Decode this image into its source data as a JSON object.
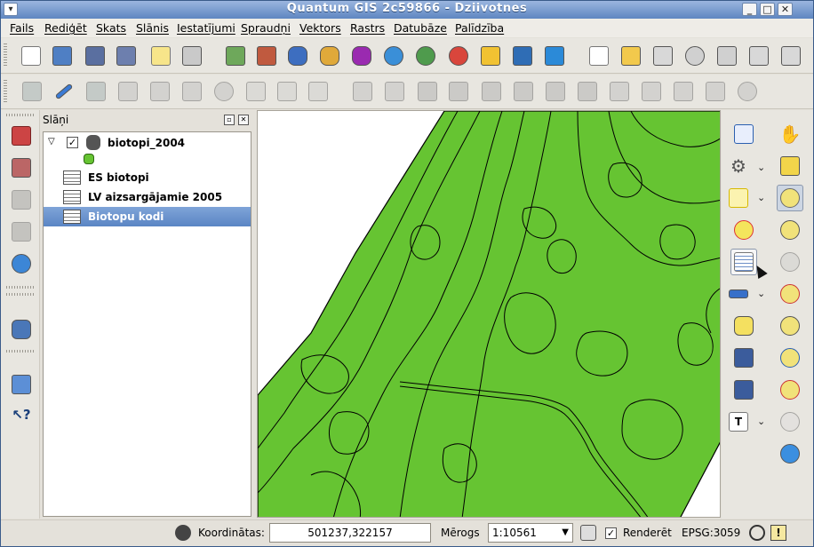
{
  "window": {
    "title": "Quantum GIS 2c59866 - Dziivotnes",
    "buttons": [
      "minimize",
      "maximize",
      "close"
    ]
  },
  "menu": {
    "items": [
      "Fails",
      "Rediģēt",
      "Skats",
      "Slānis",
      "Iestatījumi",
      "Spraudņi",
      "Vektors",
      "Rastrs",
      "Datubāze",
      "Palīdzība"
    ]
  },
  "toolbar_top": {
    "icons": [
      "new-project-icon",
      "open-project-icon",
      "save-project-icon",
      "save-as-icon",
      "print-composer-icon",
      "print-icon",
      "add-vector-icon",
      "add-raster-icon",
      "add-postgis-icon",
      "add-spatialite-icon",
      "add-mssql-icon",
      "add-wms-icon",
      "add-wcs-icon",
      "add-wfs-icon",
      "add-delimited-text-icon",
      "remove-layer-icon",
      "new-shapefile-icon",
      "spellcheck-icon",
      "label-icon",
      "tag-icon",
      "eye-icon",
      "pin-icon",
      "tag2-icon",
      "tag3-icon"
    ]
  },
  "toolbar_edit": {
    "icons": [
      "save-edits-icon",
      "toggle-editing-icon",
      "current-edits-icon",
      "capture-polygon-icon",
      "move-feature-icon",
      "node-tool-icon",
      "delete-selected-icon",
      "cut-features-icon",
      "copy-features-icon",
      "paste-features-icon",
      "undo-icon",
      "redo-icon",
      "simplify-icon",
      "add-ring-icon",
      "add-part-icon",
      "delete-ring-icon",
      "delete-part-icon",
      "reshape-icon",
      "offset-curve-icon",
      "split-features-icon",
      "merge-features-icon",
      "merge-attributes-icon",
      "rotate-point-icon"
    ]
  },
  "left_toolbar": {
    "icons": [
      "histogram-icon",
      "stretch-icon",
      "histogram2-icon",
      "local-stretch-icon",
      "globe-icon",
      "database-icon",
      "help-book-icon",
      "whats-this-icon"
    ]
  },
  "layers_panel": {
    "title": "Slāņi",
    "layers": [
      {
        "name": "biotopi_2004",
        "checked": true,
        "expanded": true
      },
      {
        "name": "ES biotopi"
      },
      {
        "name": "LV aizsargājamie 2005"
      },
      {
        "name": "Biotopu kodi",
        "selected": true
      }
    ]
  },
  "map": {
    "fill_color": "#66c432",
    "line_color": "#000000"
  },
  "right_toolbar": {
    "icons": [
      "identify-icon",
      "pan-icon",
      "gear-icon",
      "pan-to-selection-icon",
      "select-feature-icon",
      "zoom-in-icon",
      "deselect-icon",
      "zoom-out-icon",
      "open-attribute-table-icon",
      "zoom-actual-icon",
      "measure-icon",
      "zoom-full-icon",
      "annotation-icon",
      "zoom-layer-icon",
      "zoom-selection-icon",
      "map-tip-icon",
      "zoom-last-icon",
      "home-icon",
      "zoom-next-icon",
      "text-annotation-icon",
      "refresh-icon"
    ]
  },
  "status": {
    "coordinates_label": "Koordinātas:",
    "coordinates_value": "501237,322157",
    "scale_label": "Mērogs",
    "scale_value": "1:10561",
    "render_label": "Renderēt",
    "render_checked": true,
    "crs": "EPSG:3059"
  }
}
